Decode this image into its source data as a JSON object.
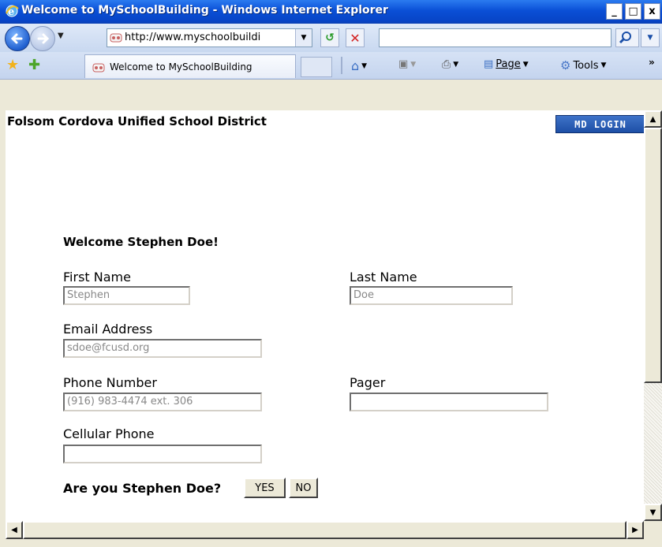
{
  "window": {
    "title": "Welcome to MySchoolBuilding - Windows Internet Explorer",
    "controls": {
      "minimize": "_",
      "maximize": "□",
      "close": "x"
    }
  },
  "address_bar": {
    "url": "http://www.myschoolbuildi",
    "search_value": ""
  },
  "tab_bar": {
    "tab_label": "Welcome to MySchoolBuilding",
    "page_label": "Page",
    "tools_label": "Tools",
    "overflow": "»"
  },
  "page": {
    "org_name": "Folsom Cordova Unified School District",
    "md_login": "MD LOGIN",
    "welcome": "Welcome Stephen Doe!",
    "fields": {
      "first_name": {
        "label": "First Name",
        "value": "Stephen"
      },
      "last_name": {
        "label": "Last Name",
        "value": "Doe"
      },
      "email": {
        "label": "Email Address",
        "value": "sdoe@fcusd.org"
      },
      "phone": {
        "label": "Phone Number",
        "value": "(916) 983-4474 ext. 306"
      },
      "pager": {
        "label": "Pager",
        "value": ""
      },
      "cellular": {
        "label": "Cellular Phone",
        "value": ""
      }
    },
    "question": "Are you Stephen Doe?",
    "yes_label": "YES",
    "no_label": "NO"
  },
  "icons": [
    "ie-logo-icon",
    "back-arrow-icon",
    "forward-arrow-icon",
    "refresh-icon",
    "stop-icon",
    "search-icon",
    "favorites-star-icon",
    "add-favorite-icon",
    "site-favicon",
    "home-icon",
    "feeds-icon",
    "print-icon",
    "page-icon",
    "tools-gear-icon"
  ]
}
